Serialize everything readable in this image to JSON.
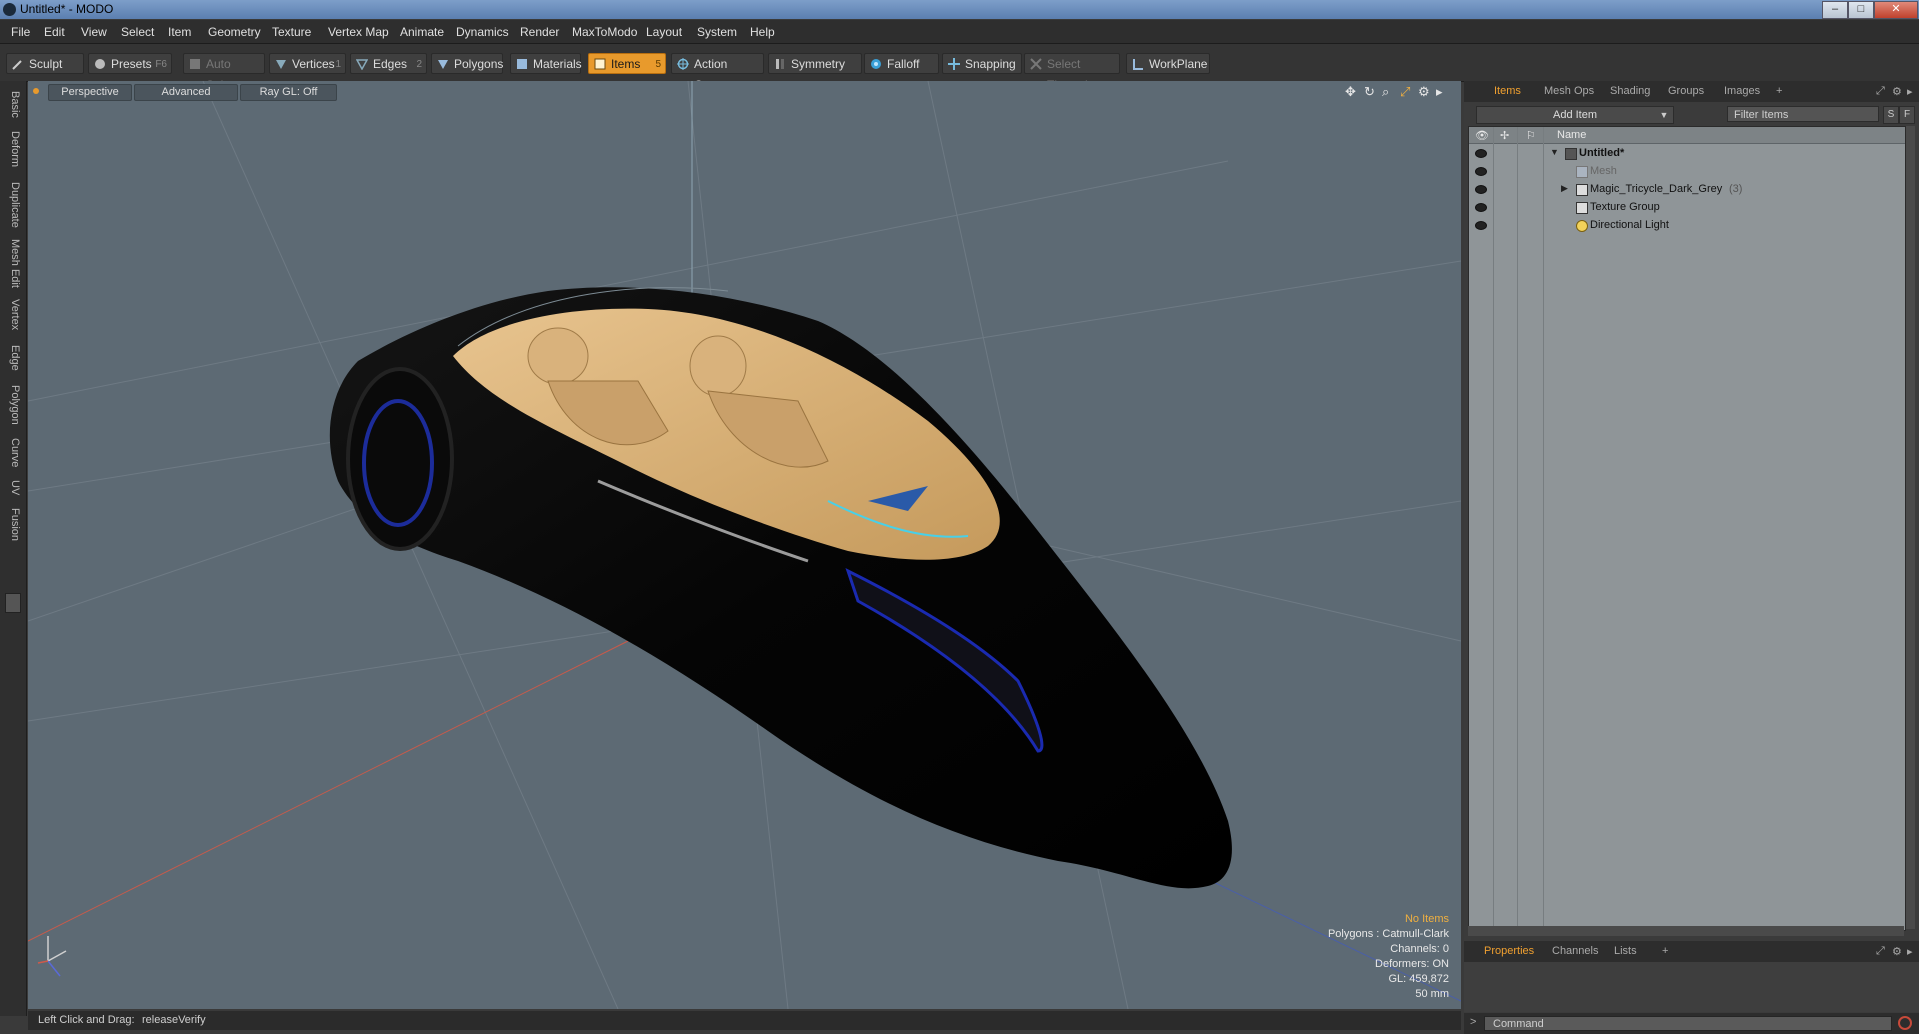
{
  "window": {
    "title": "Untitled* - MODO"
  },
  "menu": [
    "File",
    "Edit",
    "View",
    "Select",
    "Item",
    "Geometry",
    "Texture",
    "Vertex Map",
    "Animate",
    "Dynamics",
    "Render",
    "MaxToModo",
    "Layout",
    "System",
    "Help"
  ],
  "toolbar": {
    "sculpt": "Sculpt",
    "presets": "Presets",
    "presets_key": "F6",
    "auto_select": "Auto Select",
    "vertices": "Vertices",
    "vertices_key": "1",
    "edges": "Edges",
    "edges_key": "2",
    "polygons": "Polygons",
    "materials": "Materials",
    "items": "Items",
    "items_key": "5",
    "action_center": "Action Center",
    "symmetry": "Symmetry",
    "falloff": "Falloff",
    "snapping": "Snapping",
    "select_through": "Select Through",
    "workplane": "WorkPlane"
  },
  "left_tabs": [
    "Basic",
    "Deform",
    "Duplicate",
    "Mesh Edit",
    "Vertex",
    "Edge",
    "Polygon",
    "Curve",
    "UV",
    "Fusion"
  ],
  "viewport": {
    "view_mode": "Perspective",
    "shading_mode": "Advanced",
    "raygl": "Ray GL: Off",
    "info": {
      "selection": "No Items",
      "polygons": "Polygons : Catmull-Clark",
      "channels": "Channels: 0",
      "deformers": "Deformers: ON",
      "gl": "GL: 459,872",
      "scale": "50 mm"
    }
  },
  "status": {
    "hint": "Left Click and Drag:",
    "action": "releaseVerify"
  },
  "items_panel": {
    "tabs": [
      "Items",
      "Mesh Ops",
      "Shading",
      "Groups",
      "Images"
    ],
    "add_item": "Add Item",
    "filter_placeholder": "Filter Items",
    "filter_s": "S",
    "filter_f": "F",
    "column_name": "Name",
    "rows": [
      {
        "name": "Untitled*",
        "count": ""
      },
      {
        "name": "Mesh",
        "count": ""
      },
      {
        "name": "Magic_Tricycle_Dark_Grey",
        "count": "(3)"
      },
      {
        "name": "Texture Group",
        "count": ""
      },
      {
        "name": "Directional Light",
        "count": ""
      }
    ]
  },
  "bottom_panel": {
    "tabs": [
      "Properties",
      "Channels",
      "Lists"
    ],
    "command_placeholder": "Command"
  },
  "colors": {
    "accent": "#e89a2c",
    "viewport_bg": "#5d6a74",
    "item_list_bg": "#8f9598"
  }
}
